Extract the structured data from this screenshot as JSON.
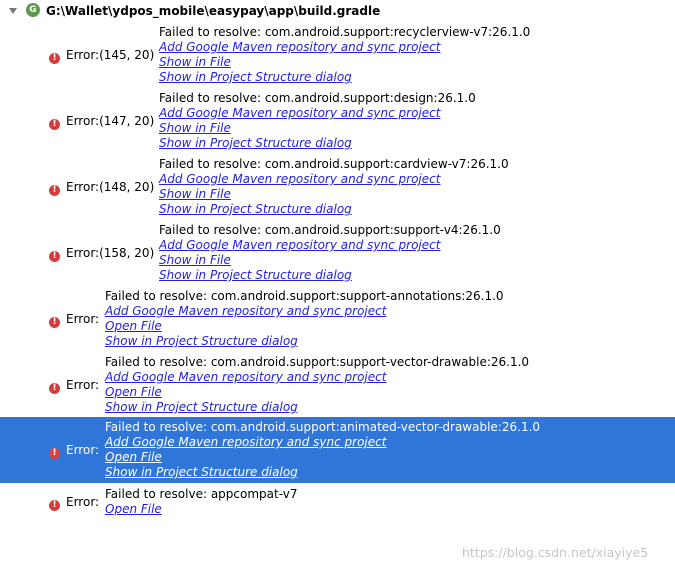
{
  "header": {
    "path": "G:\\Wallet\\ydpos_mobile\\easypay\\app\\build.gradle",
    "gradle_icon_letter": "G"
  },
  "errors": [
    {
      "label": "Error:(145, 20)",
      "message": "Failed to resolve: com.android.support:recyclerview-v7:26.1.0",
      "links": [
        "Add Google Maven repository and sync project",
        "Show in File",
        "Show in Project Structure dialog"
      ]
    },
    {
      "label": "Error:(147, 20)",
      "message": "Failed to resolve: com.android.support:design:26.1.0",
      "links": [
        "Add Google Maven repository and sync project",
        "Show in File",
        "Show in Project Structure dialog"
      ]
    },
    {
      "label": "Error:(148, 20)",
      "message": "Failed to resolve: com.android.support:cardview-v7:26.1.0",
      "links": [
        "Add Google Maven repository and sync project",
        "Show in File",
        "Show in Project Structure dialog"
      ]
    },
    {
      "label": "Error:(158, 20)",
      "message": "Failed to resolve: com.android.support:support-v4:26.1.0",
      "links": [
        "Add Google Maven repository and sync project",
        "Show in File",
        "Show in Project Structure dialog"
      ]
    },
    {
      "label": "Error:",
      "message": "Failed to resolve: com.android.support:support-annotations:26.1.0",
      "links": [
        "Add Google Maven repository and sync project",
        "Open File",
        "Show in Project Structure dialog"
      ]
    },
    {
      "label": "Error:",
      "message": "Failed to resolve: com.android.support:support-vector-drawable:26.1.0",
      "links": [
        "Add Google Maven repository and sync project",
        "Open File",
        "Show in Project Structure dialog"
      ]
    },
    {
      "label": "Error:",
      "message": "Failed to resolve: com.android.support:animated-vector-drawable:26.1.0",
      "links": [
        "Add Google Maven repository and sync project",
        "Open File",
        "Show in Project Structure dialog"
      ]
    },
    {
      "label": "Error:",
      "message": "Failed to resolve: appcompat-v7",
      "links": [
        "Open File"
      ]
    }
  ],
  "selected_error": 6,
  "watermark": "https://blog.csdn.net/xiayiye5",
  "colors": {
    "selection": "#3075d8",
    "link": "#2323d6",
    "error_icon": "#d63b3b"
  }
}
